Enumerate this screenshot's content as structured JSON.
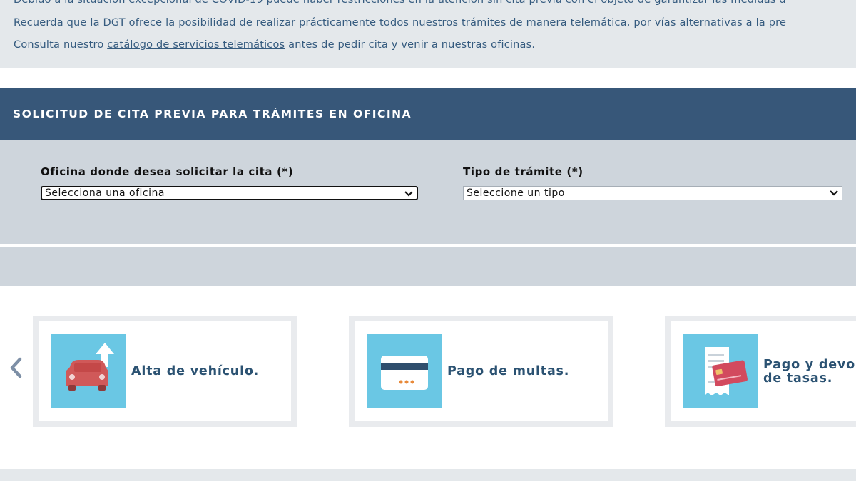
{
  "notice": {
    "line1": "Debido a la situación excepcional de COVID-19 puede haber restricciones en la atención sin cita previa con el objeto de garantizar las medidas d",
    "line2": "Recuerda que la DGT ofrece la posibilidad de realizar prácticamente todos nuestros trámites de manera telemática, por vías alternativas a la pre",
    "line3_before": "Consulta nuestro ",
    "line3_link": "catálogo de servicios telemáticos",
    "line3_after": " antes de pedir cita y venir a nuestras oficinas."
  },
  "header": {
    "title": "SOLICITUD DE CITA PREVIA PARA TRÁMITES EN OFICINA"
  },
  "form": {
    "office_label": "Oficina donde desea solicitar la cita (*)",
    "office_value": "Selecciona una oficina",
    "type_label": "Tipo de trámite (*)",
    "type_value": "Seleccione un tipo"
  },
  "carousel": {
    "items": [
      {
        "label": "Alta de vehículo.",
        "icon": "car-upload-icon"
      },
      {
        "label": "Pago de multas.",
        "icon": "credit-card-icon"
      },
      {
        "label_line1": "Pago y devo",
        "label_line2": "de tasas.",
        "icon": "receipt-card-icon"
      }
    ]
  },
  "colors": {
    "header_bg": "#375779",
    "form_bg": "#ced5dc",
    "notice_bg": "#e4e8eb",
    "tile_bg": "#6ac7e4",
    "card_title": "#2b5272"
  }
}
